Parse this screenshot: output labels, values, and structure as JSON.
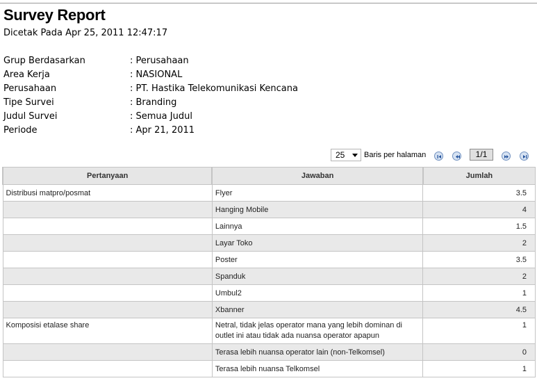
{
  "report": {
    "title": "Survey Report",
    "printed_at": "Dicetak Pada Apr 25, 2011 12:47:17"
  },
  "filters": [
    {
      "label": "Grup Berdasarkan",
      "value": ": Perusahaan"
    },
    {
      "label": "Area Kerja",
      "value": ": NASIONAL"
    },
    {
      "label": "Perusahaan",
      "value": ": PT. Hastika Telekomunikasi Kencana"
    },
    {
      "label": "Tipe Survei",
      "value": ": Branding"
    },
    {
      "label": "Judul Survei",
      "value": ": Semua Judul"
    },
    {
      "label": "Periode",
      "value": ": Apr 21, 2011"
    }
  ],
  "pager": {
    "page_size": "25",
    "per_page_label": "Baris per halaman",
    "page_indicator": "1/1",
    "icons": [
      "first-page-icon",
      "previous-page-icon",
      "next-page-icon",
      "last-page-icon"
    ]
  },
  "table": {
    "columns": [
      "Pertanyaan",
      "Jawaban",
      "Jumlah"
    ],
    "rows": [
      {
        "question": "Distribusi matpro/posmat",
        "answer": "Flyer",
        "count": "3.5"
      },
      {
        "question": "",
        "answer": "Hanging Mobile",
        "count": "4"
      },
      {
        "question": "",
        "answer": "Lainnya",
        "count": "1.5"
      },
      {
        "question": "",
        "answer": "Layar Toko",
        "count": "2"
      },
      {
        "question": "",
        "answer": "Poster",
        "count": "3.5"
      },
      {
        "question": "",
        "answer": "Spanduk",
        "count": "2"
      },
      {
        "question": "",
        "answer": "Umbul2",
        "count": "1"
      },
      {
        "question": "",
        "answer": "Xbanner",
        "count": "4.5"
      },
      {
        "question": "Komposisi etalase share",
        "answer": "Netral, tidak jelas operator mana yang lebih dominan di outlet ini atau tidak ada nuansa operator apapun",
        "count": "1"
      },
      {
        "question": "",
        "answer": "Terasa lebih nuansa operator lain (non-Telkomsel)",
        "count": "0"
      },
      {
        "question": "",
        "answer": "Terasa lebih nuansa Telkomsel",
        "count": "1"
      }
    ]
  },
  "colors": {
    "header_bg": "#e6e6e6",
    "alt_row_bg": "#e9e9e9",
    "border": "#c4c4c4",
    "nav_button": "#d6e2f2"
  }
}
